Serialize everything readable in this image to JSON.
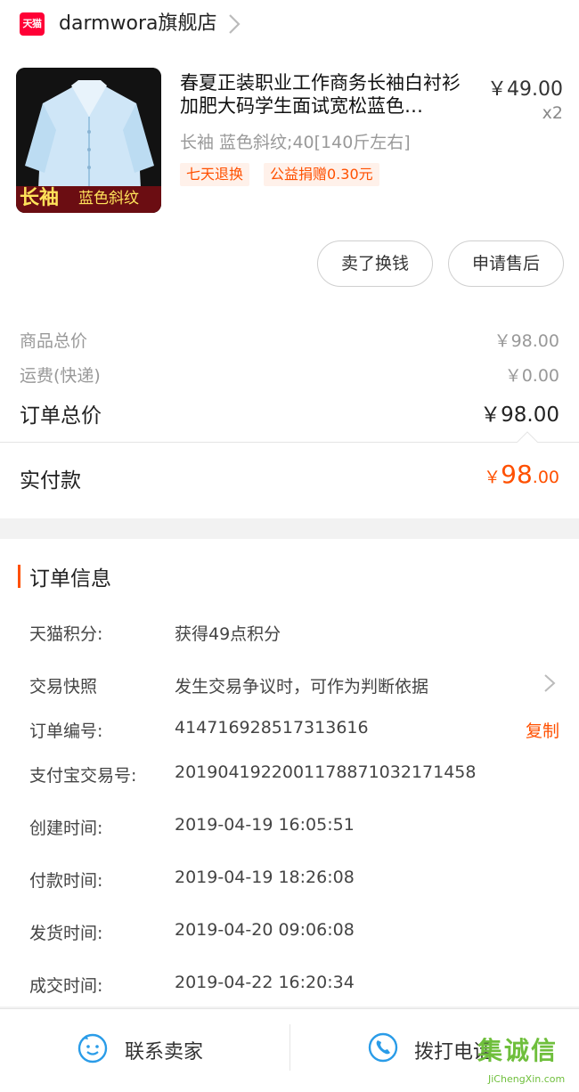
{
  "store": {
    "badge": "天猫",
    "name": "darmwora旗舰店"
  },
  "product": {
    "title": "春夏正装职业工作商务长袖白衬衫加肥大码学生面试宽松蓝色…",
    "price": "￥49.00",
    "quantity": "x2",
    "spec": "长袖 蓝色斜纹;40[140斤左右]",
    "image_tag_main": "长袖",
    "image_tag_sub": "蓝色斜纹",
    "tags": [
      "七天退换",
      "公益捐赠0.30元"
    ]
  },
  "actions": {
    "resell": "卖了换钱",
    "after_sales": "申请售后"
  },
  "summary": {
    "goods_total_label": "商品总价",
    "goods_total": "￥98.00",
    "shipping_label": "运费(快递)",
    "shipping": "￥0.00",
    "order_total_label": "订单总价",
    "order_total": "￥98.00",
    "paid_label": "实付款",
    "paid_yen": "￥",
    "paid_int": "98",
    "paid_dec": ".00"
  },
  "order_info": {
    "title": "订单信息",
    "rows": [
      {
        "label": "天猫积分:",
        "value": "获得49点积分"
      },
      {
        "label": "交易快照",
        "value": "发生交易争议时，可作为判断依据"
      },
      {
        "label": "订单编号:",
        "value": "414716928517313616",
        "action": "复制"
      },
      {
        "label": "支付宝交易号:",
        "value": "2019041922001178871032171458"
      },
      {
        "label": "创建时间:",
        "value": "2019-04-19 16:05:51"
      },
      {
        "label": "付款时间:",
        "value": "2019-04-19 18:26:08"
      },
      {
        "label": "发货时间:",
        "value": "2019-04-20 09:06:08"
      },
      {
        "label": "成交时间:",
        "value": "2019-04-22 16:20:34"
      }
    ]
  },
  "bottom_bar": {
    "contact_seller": "联系卖家",
    "call_phone": "拨打电话"
  },
  "watermark": {
    "text": "集诚信",
    "url_text": "JiChengXin.com"
  },
  "colors": {
    "accent": "#ff5000",
    "tmall_red": "#ff0036",
    "icon_blue": "#2a9ce8"
  }
}
